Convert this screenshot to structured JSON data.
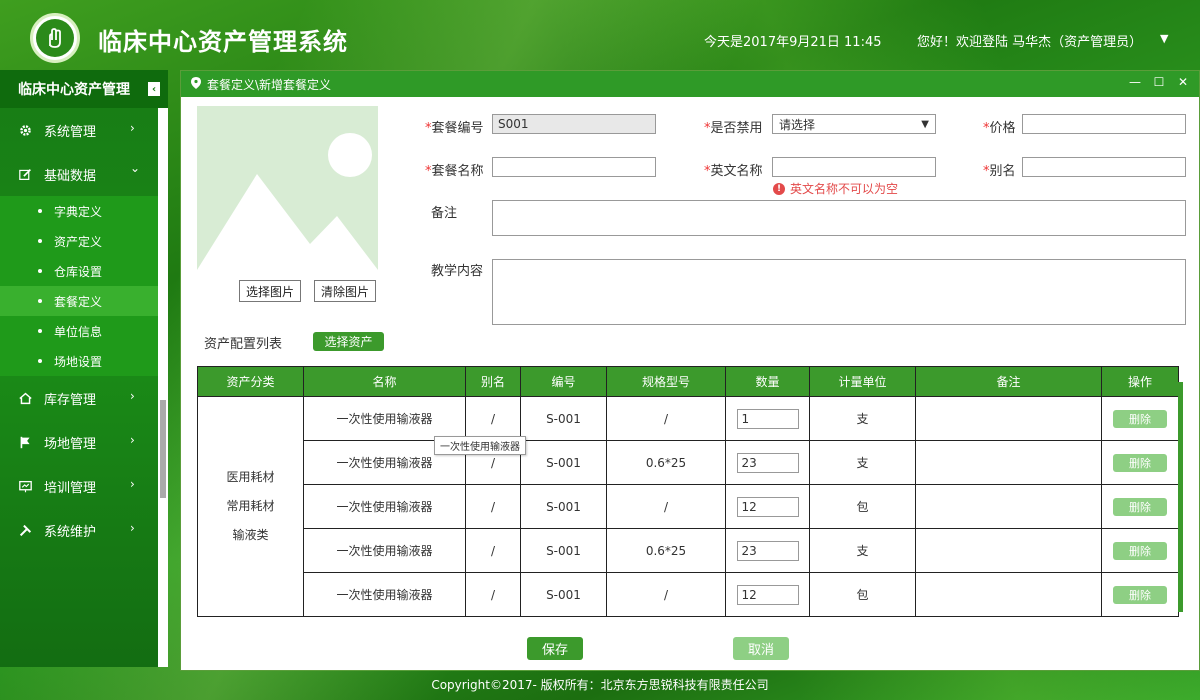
{
  "header": {
    "title": "临床中心资产管理系统",
    "date_text": "今天是2017年9月21日  11:45",
    "user_text": "您好！欢迎登陆  马华杰（资产管理员）",
    "user_caret": "▼"
  },
  "sidebar": {
    "title": "临床中心资产管理",
    "collapse_icon": "‹",
    "menus": [
      {
        "label": "系统管理",
        "icon": "gear-icon",
        "arrow": "›"
      },
      {
        "label": "基础数据",
        "icon": "edit-icon",
        "arrow": "⌄"
      },
      {
        "label": "库存管理",
        "icon": "home-icon",
        "arrow": "›"
      },
      {
        "label": "场地管理",
        "icon": "flag-icon",
        "arrow": "›"
      },
      {
        "label": "培训管理",
        "icon": "presentation-icon",
        "arrow": "›"
      },
      {
        "label": "系统维护",
        "icon": "tools-icon",
        "arrow": "›"
      }
    ],
    "submenu": [
      {
        "label": "字典定义",
        "active": false
      },
      {
        "label": "资产定义",
        "active": false
      },
      {
        "label": "仓库设置",
        "active": false
      },
      {
        "label": "套餐定义",
        "active": true
      },
      {
        "label": "单位信息",
        "active": false
      },
      {
        "label": "场地设置",
        "active": false
      }
    ]
  },
  "panel": {
    "breadcrumb": "套餐定义\\新增套餐定义",
    "win_min": "—",
    "win_max": "☐",
    "win_close": "✕"
  },
  "form": {
    "select_image": "选择图片",
    "clear_image": "清除图片",
    "code_label": "套餐编号",
    "code_value": "S001",
    "disabled_label": "是否禁用",
    "disabled_value": "请选择",
    "price_label": "价格",
    "price_value": "",
    "name_label": "套餐名称",
    "name_value": "",
    "en_name_label": "英文名称",
    "en_name_value": "",
    "en_name_error": "英文名称不可以为空",
    "alias_label": "别名",
    "alias_value": "",
    "remark_label": "备注",
    "teaching_label": "教学内容",
    "required_mark": "*"
  },
  "asset_config": {
    "label": "资产配置列表",
    "select_button": "选择资产"
  },
  "table": {
    "headers": [
      "资产分类",
      "名称",
      "别名",
      "编号",
      "规格型号",
      "数量",
      "计量单位",
      "备注",
      "操作"
    ],
    "category_lines": [
      "医用耗材",
      "常用耗材",
      "输液类"
    ],
    "rows": [
      {
        "name": "一次性使用输液器",
        "alias": "/",
        "code": "S-001",
        "spec": "/",
        "qty": "1",
        "unit": "支",
        "remark": "",
        "action": "删除"
      },
      {
        "name": "一次性使用输液器",
        "alias": "/",
        "code": "S-001",
        "spec": "0.6*25",
        "qty": "23",
        "unit": "支",
        "remark": "",
        "action": "删除"
      },
      {
        "name": "一次性使用输液器",
        "alias": "/",
        "code": "S-001",
        "spec": "/",
        "qty": "12",
        "unit": "包",
        "remark": "",
        "action": "删除"
      },
      {
        "name": "一次性使用输液器",
        "alias": "/",
        "code": "S-001",
        "spec": "0.6*25",
        "qty": "23",
        "unit": "支",
        "remark": "",
        "action": "删除"
      },
      {
        "name": "一次性使用输液器",
        "alias": "/",
        "code": "S-001",
        "spec": "/",
        "qty": "12",
        "unit": "包",
        "remark": "",
        "action": "删除"
      }
    ],
    "tooltip": "一次性使用输液器"
  },
  "actions": {
    "save": "保存",
    "cancel": "取消"
  },
  "footer": {
    "copyright": "Copyright©2017- 版权所有：北京东方思锐科技有限责任公司"
  },
  "colors": {
    "primary_green": "#3c9a2c",
    "sidebar_green": "#187c15",
    "active_sub": "#39b02e",
    "error_red": "#e34a4a",
    "light_button": "#8ecf84"
  }
}
